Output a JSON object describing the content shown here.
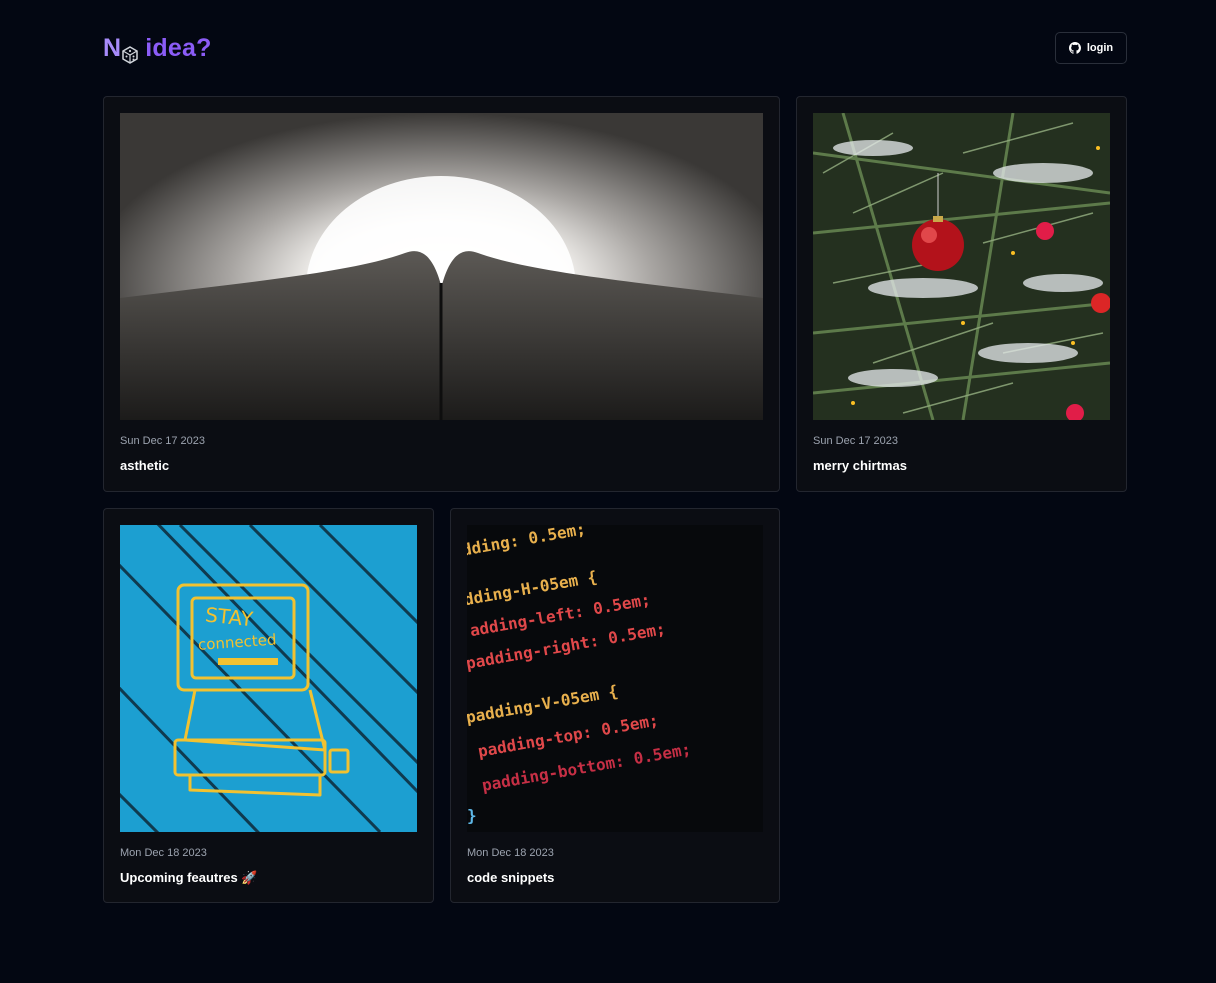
{
  "header": {
    "logo_first": "N",
    "logo_rest": " idea?",
    "logo_icon": "dice-icon",
    "login_label": "login",
    "login_icon": "github-icon"
  },
  "posts": [
    {
      "date": "Sun Dec 17 2023",
      "title": "asthetic",
      "image": "tunnel-light-photo"
    },
    {
      "date": "Sun Dec 17 2023",
      "title": "merry chirtmas",
      "image": "christmas-tree-ornament-photo"
    },
    {
      "date": "Mon Dec 18 2023",
      "title": "Upcoming feautres 🚀",
      "image": "stay-connected-graffiti-photo"
    },
    {
      "date": "Mon Dec 18 2023",
      "title": "code snippets",
      "image": "css-code-photo"
    }
  ],
  "code_image_lines": [
    "dding: 0.5em;",
    "dding-H-05em {",
    "adding-left: 0.5em;",
    "padding-right: 0.5em;",
    "padding-V-05em {",
    "padding-top: 0.5em;",
    "padding-bottom: 0.5em;",
    "}"
  ],
  "graffiti_text": [
    "STAY",
    "connected"
  ],
  "colors": {
    "background": "#030712",
    "card": "#0b0d13",
    "border": "#23262f",
    "accent": "#8b5cf6",
    "accent_light": "#a78bfa",
    "muted": "#9ca3af"
  }
}
